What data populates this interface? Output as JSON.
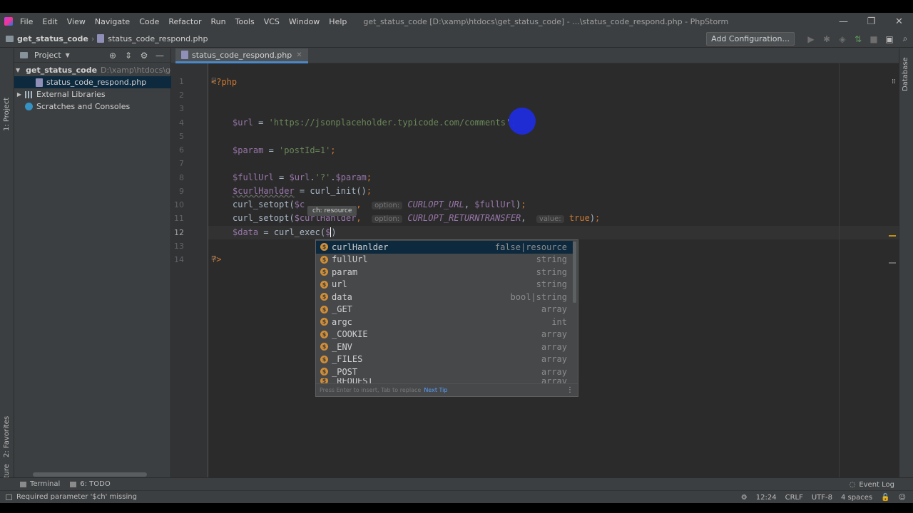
{
  "menu": {
    "items": [
      "File",
      "Edit",
      "View",
      "Navigate",
      "Code",
      "Refactor",
      "Run",
      "Tools",
      "VCS",
      "Window",
      "Help"
    ],
    "window_title": "get_status_code [D:\\xamp\\htdocs\\get_status_code] - ...\\status_code_respond.php - PhpStorm"
  },
  "window_controls": {
    "minimize": "—",
    "restore": "❐",
    "close": "✕"
  },
  "navbar": {
    "project": "get_status_code",
    "file": "status_code_respond.php",
    "add_configuration": "Add Configuration..."
  },
  "left_strip": {
    "project_tab": "1: Project",
    "favorites_tab": "2: Favorites",
    "structure_tab": "Z: Structure"
  },
  "right_strip": {
    "database_tab": "Database"
  },
  "project_panel": {
    "title": "Project",
    "tree": [
      {
        "label": "get_status_code",
        "path": "D:\\xamp\\htdocs\\get_stat",
        "type": "folder",
        "expanded": true
      },
      {
        "label": "status_code_respond.php",
        "type": "file",
        "selected": true
      },
      {
        "label": "External Libraries",
        "type": "library"
      },
      {
        "label": "Scratches and Consoles",
        "type": "scratch"
      }
    ]
  },
  "editor": {
    "tab_label": "status_code_respond.php",
    "line_numbers": [
      "1",
      "2",
      "3",
      "4",
      "5",
      "6",
      "7",
      "8",
      "9",
      "10",
      "11",
      "12",
      "13",
      "14"
    ],
    "current_line": 12,
    "code": {
      "l1": "<?php",
      "l4_var": "$url",
      "l4_eq": " = ",
      "l4_str": "'https://jsonplaceholder.typicode.com/comments'",
      "l4_end": ";",
      "l6_var": "$param",
      "l6_str": "'postId=1'",
      "l8_var1": "$fullUrl",
      "l8_var2": "$url",
      "l8_str": "'?'",
      "l8_var3": "$param",
      "l9_var": "$curlHanlder",
      "l9_fn": "curl_init",
      "l10_fn": "curl_setopt",
      "l10_arg": "$c",
      "l10_hint": "option:",
      "l10_const": "CURLOPT_URL",
      "l10_var": "$fullUrl",
      "l11_fn": "curl_setopt",
      "l11_arg": "$curlHanlder",
      "l11_hint": "option:",
      "l11_const": "CURLOPT_RETURNTRANSFER",
      "l11_hint2": "value:",
      "l11_val": "true",
      "l12_var": "$data",
      "l12_fn": "curl_exec",
      "l12_arg": "$",
      "l14": "?>"
    },
    "param_tooltip": "ch: resource"
  },
  "completion": {
    "items": [
      {
        "name": "curlHanlder",
        "type": "false|resource"
      },
      {
        "name": "fullUrl",
        "type": "string"
      },
      {
        "name": "param",
        "type": "string"
      },
      {
        "name": "url",
        "type": "string"
      },
      {
        "name": "data",
        "type": "bool|string"
      },
      {
        "name": "_GET",
        "type": "array"
      },
      {
        "name": "argc",
        "type": "int"
      },
      {
        "name": "_COOKIE",
        "type": "array"
      },
      {
        "name": "_ENV",
        "type": "array"
      },
      {
        "name": "_FILES",
        "type": "array"
      },
      {
        "name": "_POST",
        "type": "array"
      },
      {
        "name": "_REQUEST",
        "type": "array"
      }
    ],
    "footer_text": "Press Enter to insert, Tab to replace",
    "footer_link": "Next Tip"
  },
  "bottom_tabs": {
    "terminal": "Terminal",
    "todo": "6: TODO",
    "event_log": "Event Log"
  },
  "status": {
    "message": "Required parameter '$ch' missing",
    "position": "12:24",
    "line_sep": "CRLF",
    "encoding": "UTF-8",
    "indent": "4 spaces"
  },
  "colors": {
    "accent": "#4a88c7",
    "keyword": "#cc7832",
    "variable": "#9876aa",
    "string": "#6a8759",
    "cursor_highlight": "#1f2cdc"
  }
}
